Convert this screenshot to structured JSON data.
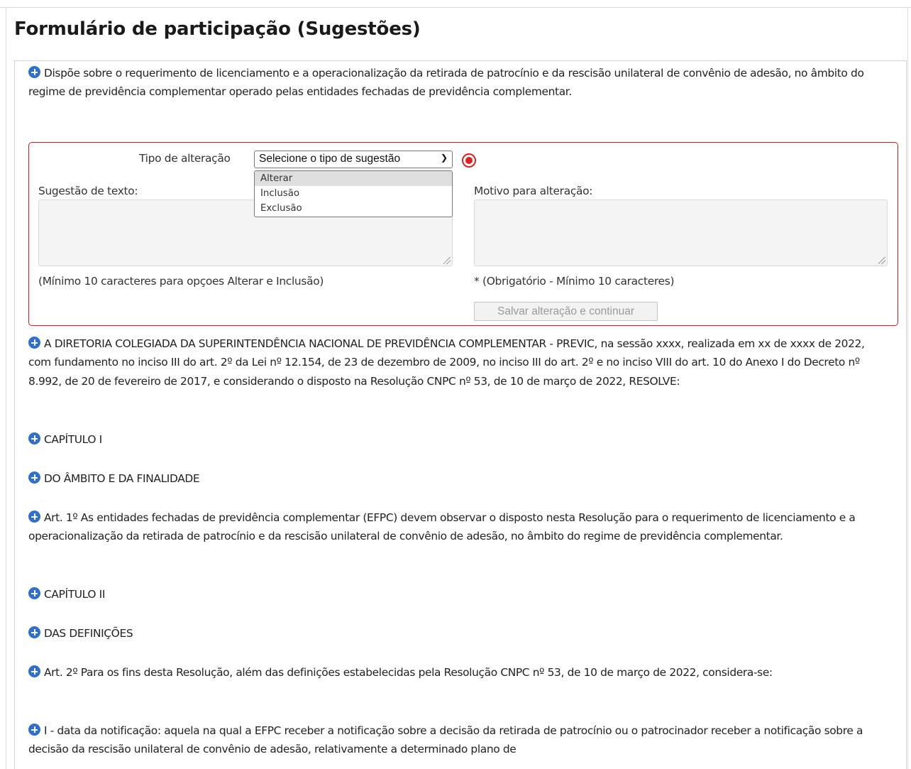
{
  "page_title": "Formulário de participação (Sugestões)",
  "intro": "Dispõe sobre o requerimento de licenciamento e a operacionalização da retirada de patrocínio e da rescisão unilateral de convênio de adesão, no âmbito do regime de previdência complementar operado pelas entidades fechadas de previdência complementar.",
  "form": {
    "tipo_label": "Tipo de alteração",
    "tipo_select_value": "Selecione o tipo de sugestão",
    "tipo_options": [
      "Alterar",
      "Inclusão",
      "Exclusão"
    ],
    "sugestao_label": "Sugestão de texto:",
    "sugestao_hint": "(Mínimo 10 caracteres para opçoes Alterar e Inclusão)",
    "motivo_label": "Motivo para alteração:",
    "motivo_hint": "* (Obrigatório - Mínimo 10 caracteres)",
    "save_label": "Salvar alteração e continuar"
  },
  "paragraphs": [
    "A DIRETORIA COLEGIADA DA SUPERINTENDÊNCIA NACIONAL DE PREVIDÊNCIA COMPLEMENTAR - PREVIC, na sessão xxxx, realizada em xx de xxxx de 2022, com fundamento no inciso III do art. 2º da Lei nº 12.154, de 23 de dezembro de 2009, no inciso III do art. 2º e no inciso VIII do art. 10 do Anexo I do Decreto nº 8.992, de 20 de fevereiro de 2017, e considerando o disposto na Resolução CNPC nº 53, de 10 de março de 2022, RESOLVE:",
    "CAPÍTULO I",
    "DO ÂMBITO E DA FINALIDADE",
    "Art. 1º As entidades fechadas de previdência complementar (EFPC) devem observar o disposto nesta Resolução para o requerimento de licenciamento e a operacionalização da retirada de patrocínio e da rescisão unilateral de convênio de adesão, no âmbito do regime de previdência complementar.",
    "CAPÍTULO II",
    "DAS DEFINIÇÕES",
    "Art. 2º Para os fins desta Resolução, além das definições estabelecidas pela Resolução CNPC nº 53, de 10 de março de 2022, considera-se:",
    "I - data da notificação: aquela na qual a EFPC receber a notificação sobre a decisão da retirada de patrocínio ou o patrocinador receber a notificação sobre a decisão da rescisão unilateral de convênio de adesão, relativamente a determinado plano de"
  ]
}
